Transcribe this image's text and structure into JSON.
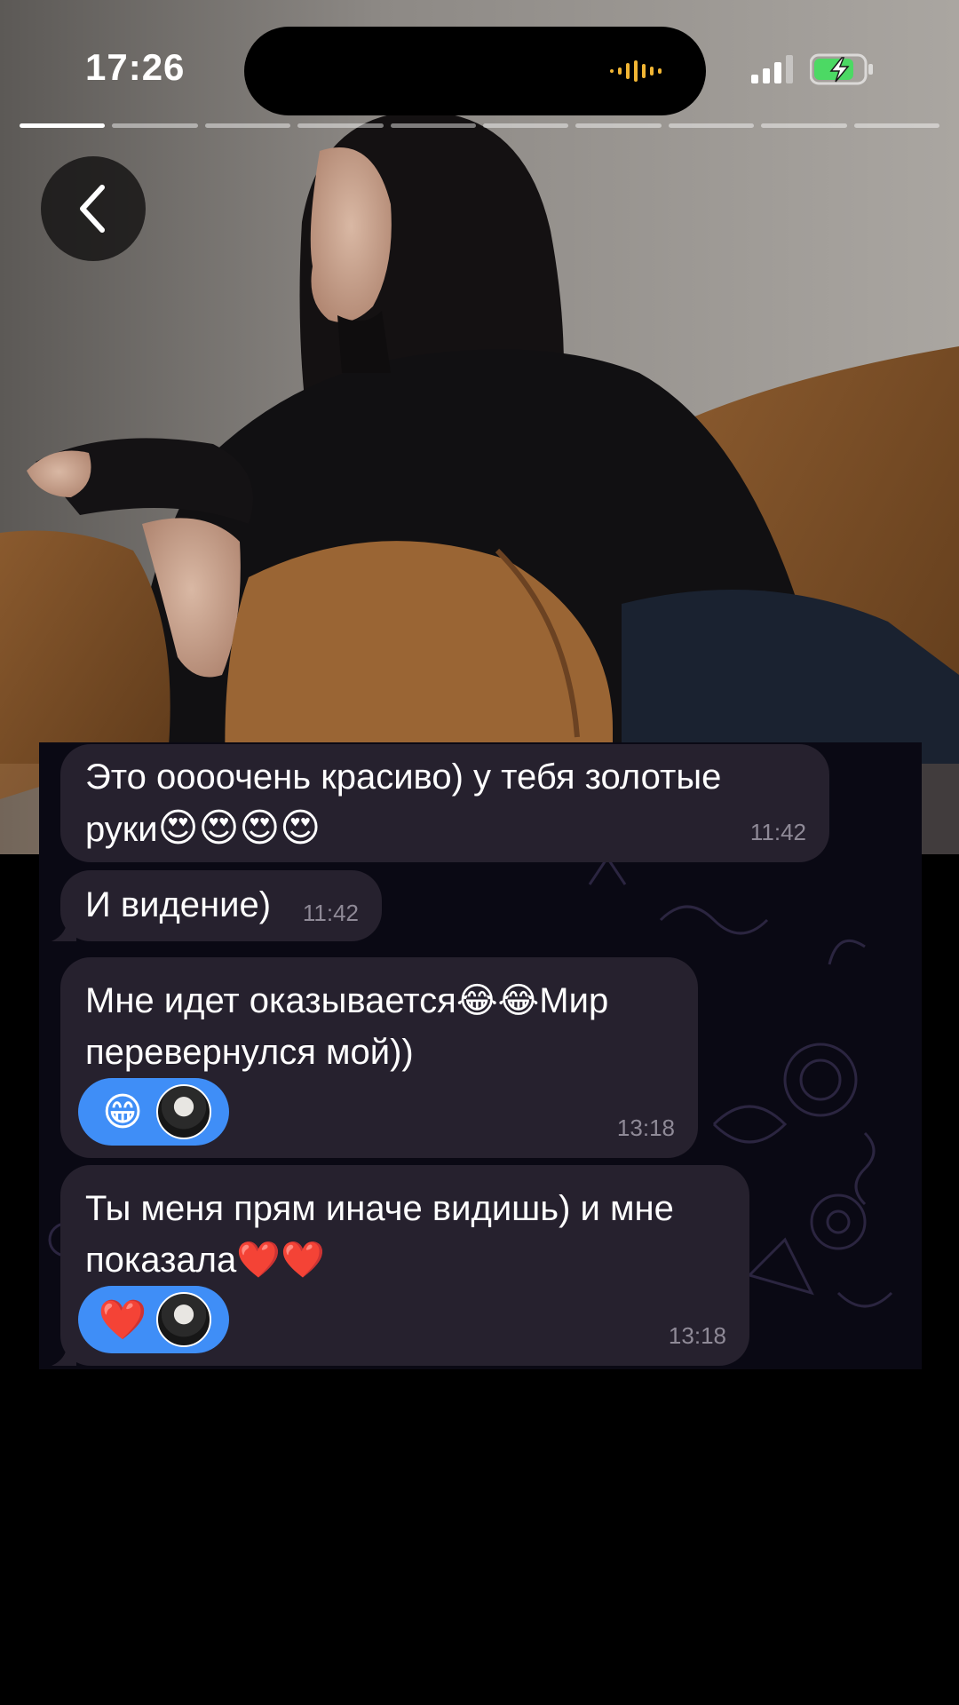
{
  "status_bar": {
    "time": "17:26"
  },
  "story": {
    "segments_total": 10,
    "segments_active": 1
  },
  "icons": {
    "back": "chevron-left-icon",
    "signal": "cellular-signal-icon",
    "battery": "battery-charging-icon"
  },
  "colors": {
    "bubble": "#26212e",
    "reaction": "#3f8ef7",
    "chat_background": "#0a0914",
    "battery": "#4cd964"
  },
  "messages": [
    {
      "text_line1": "Это oooочень красиво) у тебя золотые",
      "text_line2": "руки",
      "emojis": "😍😍😍😍",
      "time": "11:42"
    },
    {
      "text": "И видение)",
      "time": "11:42"
    },
    {
      "text_line1_a": "Мне идет оказывается",
      "emojis": "😂😂",
      "text_line1_b": "Мир",
      "text_line2": "перевернулся мой))",
      "reaction": "😁",
      "time": "13:18"
    },
    {
      "text_line1": "Ты меня прям иначе видишь) и мне",
      "text_line2": "показала",
      "emojis": "❤️❤️",
      "reaction": "❤️",
      "time": "13:18"
    }
  ]
}
